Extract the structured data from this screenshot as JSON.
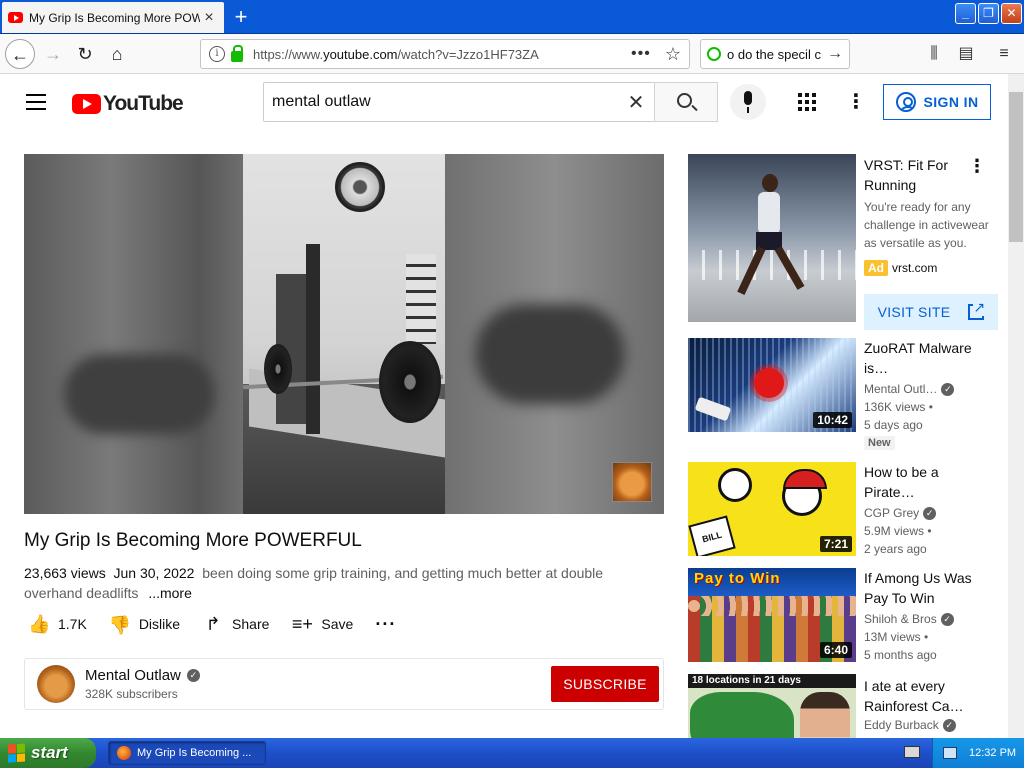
{
  "browser": {
    "tab_title": "My Grip Is Becoming More POWERFUL",
    "tab_close": "×",
    "new_tab": "+",
    "url_prefix": "https://www.",
    "url_domain": "youtube.com",
    "url_path": "/watch?v=Jzzo1HF73ZA",
    "page_actions": "•••",
    "search_text": "o do the specil c",
    "window_buttons": [
      "_",
      "❐",
      "✕"
    ]
  },
  "youtube": {
    "logo_text": "YouTube",
    "search_query": "mental outlaw",
    "sign_in": "SIGN IN",
    "video": {
      "title": "My Grip Is Becoming More POWERFUL",
      "views": "23,663 views",
      "date": "Jun 30, 2022",
      "description": "been doing some grip training, and getting much better at double overhand deadlifts",
      "more": "...more",
      "likes": "1.7K",
      "dislike_label": "Dislike",
      "share_label": "Share",
      "save_label": "Save"
    },
    "channel": {
      "name": "Mental Outlaw",
      "subscribers": "328K subscribers",
      "subscribe_label": "SUBSCRIBE"
    },
    "ad": {
      "title": "VRST: Fit For Running",
      "description": "You're ready for any challenge in activewear as versatile as you.",
      "badge": "Ad",
      "domain": "vrst.com",
      "cta": "VISIT SITE"
    },
    "recommendations": [
      {
        "title": "ZuoRAT Malware is…",
        "channel": "Mental Outl…",
        "views": "136K views •",
        "age": "5 days ago",
        "badge": "New",
        "duration": "10:42"
      },
      {
        "title": "How to be a Pirate…",
        "channel": "CGP Grey",
        "views": "5.9M views •",
        "age": "2 years ago",
        "duration": "7:21",
        "thumb_text": "BILL"
      },
      {
        "title": "If Among Us Was Pay To Win",
        "channel": "Shiloh & Bros",
        "views": "13M views •",
        "age": "5 months ago",
        "duration": "6:40",
        "thumb_text": "Pay to Win"
      },
      {
        "title": "I ate at every Rainforest Ca…",
        "channel": "Eddy Burback",
        "thumb_text": "18 locations in 21 days"
      }
    ]
  },
  "taskbar": {
    "start_label": "start",
    "task_label": "My Grip Is Becoming ...",
    "clock": "12:32 PM"
  },
  "colors": {
    "youtube_red": "#ff0000",
    "subscribe_red": "#cc0000",
    "link_blue": "#065fd4",
    "xp_blue": "#1e4fc9",
    "xp_green": "#33892f"
  }
}
